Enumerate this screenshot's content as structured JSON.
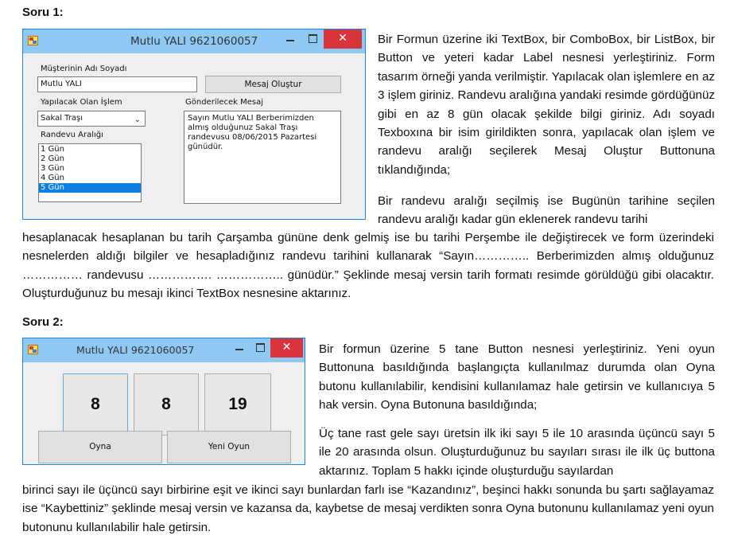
{
  "q1": {
    "heading": "Soru 1:",
    "window": {
      "title": "Mutlu YALI 9621060057",
      "label_name": "Müşterinin Adı Soyadı",
      "input_name_value": "Mutlu YALI",
      "button_create": "Mesaj Oluştur",
      "label_operation": "Yapılacak Olan İşlem",
      "combo_selected": "Sakal Traşı",
      "label_range": "Randevu Aralığı",
      "range_items": [
        "1 Gün",
        "2 Gün",
        "3 Gün",
        "4 Gün",
        "5 Gün"
      ],
      "label_message": "Gönderilecek Mesaj",
      "message_text": "Sayın Mutlu YALI Berberimizden almış olduğunuz Sakal Traşı randevusu 08/06/2015 Pazartesi günüdür."
    },
    "para_side": "Bir Formun üzerine iki TextBox, bir ComboBox, bir ListBox, bir Button ve yeteri kadar Label nesnesi yerleştiriniz. Form tasarım örneği yanda verilmiştir.  Yapılacak olan işlemlere en az 3 işlem giriniz. Randevu aralığına yandaki resimde gördüğünüz gibi en az 8 gün olacak şekilde bilgi giriniz. Adı soyadı Texboxına bir isim girildikten sonra, yapılacak olan işlem ve randevu aralığı seçilerek Mesaj Oluştur Buttonuna tıklandığında;",
    "para_side_2": "Bir randevu aralığı seçilmiş ise Bugünün tarihine seçilen randevu aralığı kadar gün eklenerek randevu tarihi",
    "para_full": "hesaplanacak hesaplanan bu tarih Çarşamba gününe denk gelmiş ise bu tarihi Perşembe ile değiştirecek ve form üzerindeki nesnelerden aldığı bilgiler ve hesapladığınız randevu tarihini kullanarak “Sayın………….. Berberimizden almış olduğunuz …………… randevusu ……………. …………….. günüdür.” Şeklinde mesaj versin tarih formatı resimde görüldüğü gibi olacaktır. Oluşturduğunuz bu mesajı ikinci TextBox nesnesine aktarınız."
  },
  "q2": {
    "heading": "Soru 2:",
    "window": {
      "title": "Mutlu YALI 9621060057",
      "numbers": [
        "8",
        "8",
        "19"
      ],
      "button_play": "Oyna",
      "button_new": "Yeni Oyun"
    },
    "para_side": "Bir formun üzerine 5 tane Button nesnesi yerleştiriniz. Yeni oyun Buttonuna basıldığında başlangıçta kullanılmaz durumda olan Oyna butonu kullanılabilir, kendisini kullanılamaz hale getirsin ve kullanıcıya 5 hak versin. Oyna Butonuna basıldığında;",
    "para_side_2": "Üç tane rast gele sayı üretsin ilk iki sayı 5 ile 10 arasında üçüncü sayı 5 ile 20 arasında olsun. Oluşturduğunuz bu sayıları sırası ile ilk üç buttona aktarınız. Toplam 5 hakkı içinde oluşturduğu sayılardan",
    "para_full": "birinci sayı ile üçüncü sayı birbirine eşit ve ikinci sayı bunlardan farlı ise “Kazandınız”, beşinci hakkı sonunda bu şartı sağlayamaz ise “Kaybettiniz” şeklinde mesaj versin ve kazansa da, kaybetse de mesaj verdikten sonra Oyna butonunu kullanılamaz yeni oyun butonunu kullanılabilir hale getirsin."
  }
}
